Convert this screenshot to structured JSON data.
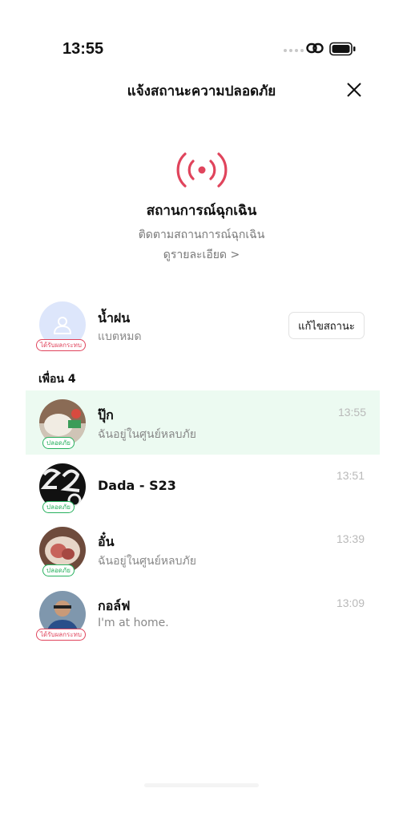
{
  "status_bar": {
    "time": "13:55",
    "icons": [
      "signal-dots",
      "link-icon",
      "battery-icon"
    ]
  },
  "header": {
    "title": "แจ้งสถานะความปลอดภัย",
    "close_icon": "close-icon"
  },
  "emergency": {
    "icon": "broadcast-icon",
    "title": "สถานการณ์ฉุกเฉิน",
    "subtitle": "ติดตามสถานการณ์ฉุกเฉิน",
    "details_link": "ดูรายละเอียด >"
  },
  "me": {
    "name": "น้ำฝน",
    "status": "แบตหมด",
    "badge": "ได้รับผลกระทบ",
    "edit_button": "แก้ไขสถานะ"
  },
  "friends_section": {
    "header": "เพื่อน 4"
  },
  "friends": [
    {
      "name": "ปุ๊ก",
      "message": "ฉันอยู่ในศูนย์หลบภัย",
      "time": "13:55",
      "badge": "ปลอดภัย"
    },
    {
      "name": "Dada - S23",
      "message": "",
      "time": "13:51",
      "badge": "ปลอดภัย"
    },
    {
      "name": "อั๋น",
      "message": "ฉันอยู่ในศูนย์หลบภัย",
      "time": "13:39",
      "badge": "ปลอดภัย"
    },
    {
      "name": "กอล์ฟ",
      "message": "I'm at home.",
      "time": "13:09",
      "badge": "ได้รับผลกระทบ"
    }
  ],
  "colors": {
    "accent_red": "#e0445c",
    "safe_green": "#27b15e",
    "highlight_bg": "#ecfaf1"
  }
}
